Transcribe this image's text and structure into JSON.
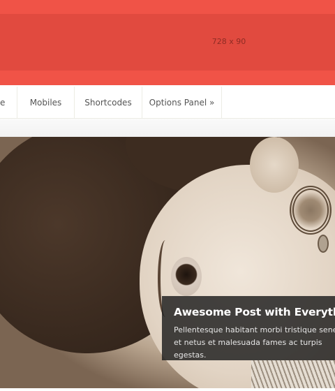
{
  "header": {
    "ad_label": "728 x 90"
  },
  "nav": {
    "items": [
      {
        "label": "e"
      },
      {
        "label": "Mobiles"
      },
      {
        "label": "Shortcodes"
      },
      {
        "label": "Options Panel »"
      }
    ]
  },
  "slider": {
    "title": "Awesome Post with Everything",
    "excerpt": "Pellentesque habitant morbi tristique senectus et netus et malesuada fames ac turpis egestas."
  },
  "colors": {
    "header_bg": "#f05347",
    "ad_bg": "#e14a3f",
    "caption_bg": "#1c1c1c"
  }
}
